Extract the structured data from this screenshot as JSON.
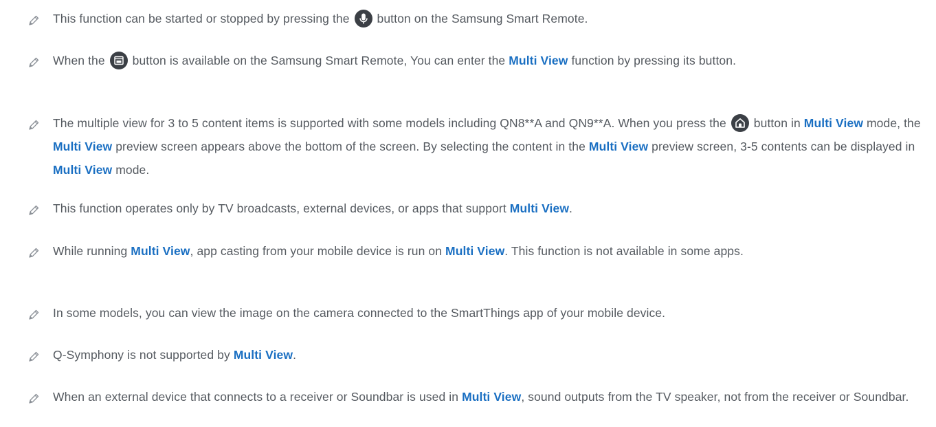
{
  "notes": [
    {
      "segments": [
        {
          "t": "This function can be started or stopped by pressing the "
        },
        {
          "icon": "microphone-icon"
        },
        {
          "t": " button on the Samsung Smart Remote."
        }
      ]
    },
    {
      "segments": [
        {
          "t": "When the "
        },
        {
          "icon": "multi-view-icon"
        },
        {
          "t": " button is available on the Samsung Smart Remote, You can enter the "
        },
        {
          "term": "Multi View"
        },
        {
          "t": " function by pressing its button."
        }
      ]
    },
    {
      "segments": [
        {
          "t": "The multiple view for 3 to 5 content items is supported with some models including QN8**A and QN9**A. When you press the "
        },
        {
          "icon": "home-icon"
        },
        {
          "t": " button in "
        },
        {
          "term": "Multi View"
        },
        {
          "t": " mode, the "
        },
        {
          "term": "Multi View"
        },
        {
          "t": " preview screen appears above the bottom of the screen. By selecting the content in the "
        },
        {
          "term": "Multi View"
        },
        {
          "t": " preview screen, 3-5 contents can be displayed in "
        },
        {
          "term": "Multi View"
        },
        {
          "t": " mode."
        }
      ]
    },
    {
      "segments": [
        {
          "t": "This function operates only by TV broadcasts, external devices, or apps that support "
        },
        {
          "term": "Multi View"
        },
        {
          "t": "."
        }
      ]
    },
    {
      "segments": [
        {
          "t": "While running "
        },
        {
          "term": "Multi View"
        },
        {
          "t": ", app casting from your mobile device is run on "
        },
        {
          "term": "Multi View"
        },
        {
          "t": ". This function is not available in some apps."
        }
      ]
    },
    {
      "segments": [
        {
          "t": "In some models, you can view the image on the camera connected to the SmartThings app of your mobile device."
        }
      ]
    },
    {
      "segments": [
        {
          "t": "Q-Symphony is not supported by "
        },
        {
          "term": "Multi View"
        },
        {
          "t": "."
        }
      ]
    },
    {
      "segments": [
        {
          "t": "When an external device that connects to a receiver or Soundbar is used in "
        },
        {
          "term": "Multi View"
        },
        {
          "t": ", sound outputs from the TV speaker, not from the receiver or Soundbar."
        }
      ]
    }
  ],
  "colors": {
    "text": "#555a60",
    "term": "#1a6fc2",
    "icon_bg": "#3b3f45",
    "pencil": "#8a8f96"
  }
}
